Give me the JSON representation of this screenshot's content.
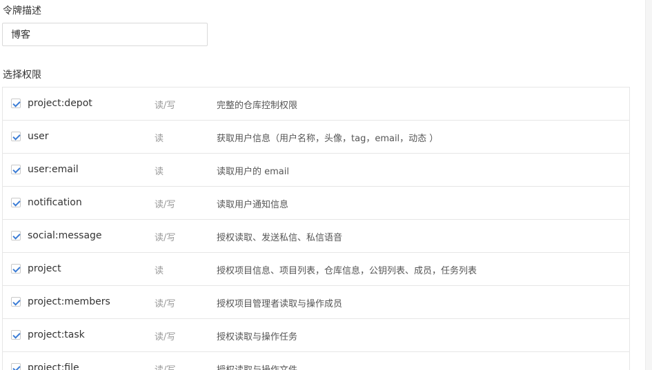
{
  "token_description": {
    "label": "令牌描述",
    "value": "博客"
  },
  "permissions": {
    "label": "选择权限",
    "rows": [
      {
        "scope": "project:depot",
        "access": "读/写",
        "description": "完整的仓库控制权限",
        "checked": true
      },
      {
        "scope": "user",
        "access": "读",
        "description": "获取用户信息（用户名称，头像，tag，email，动态 ）",
        "checked": true
      },
      {
        "scope": "user:email",
        "access": "读",
        "description": "读取用户的 email",
        "checked": true
      },
      {
        "scope": "notification",
        "access": "读/写",
        "description": "读取用户通知信息",
        "checked": true
      },
      {
        "scope": "social:message",
        "access": "读/写",
        "description": "授权读取、发送私信、私信语音",
        "checked": true
      },
      {
        "scope": "project",
        "access": "读",
        "description": "授权项目信息、项目列表，仓库信息，公钥列表、成员，任务列表",
        "checked": true
      },
      {
        "scope": "project:members",
        "access": "读/写",
        "description": "授权项目管理者读取与操作成员",
        "checked": true
      },
      {
        "scope": "project:task",
        "access": "读/写",
        "description": "授权读取与操作任务",
        "checked": true
      },
      {
        "scope": "project:file",
        "access": "读/写",
        "description": "授权读取与操作文件",
        "checked": true
      }
    ]
  },
  "colors": {
    "check_accent": "#3b7cd5",
    "border": "#e6e6e6",
    "muted_text": "#999999"
  }
}
